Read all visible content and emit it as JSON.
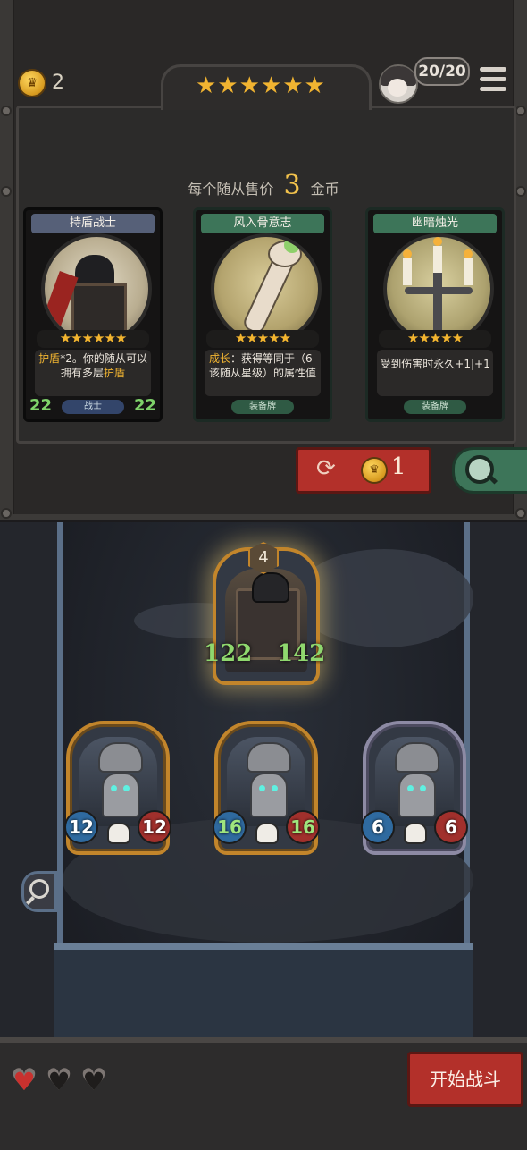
{
  "header": {
    "gold": "2",
    "tier_stars": "★★★★★★",
    "population": "20/20"
  },
  "shop": {
    "price_prefix": "每个随从售价",
    "price_value": "3",
    "price_suffix": "金币",
    "cards": [
      {
        "title": "持盾战士",
        "stars": "★★★★★★",
        "desc_hl1": "护盾",
        "desc_mid": "*2。你的随从可以拥有多层",
        "desc_hl2": "护盾",
        "type": "战士",
        "attack": "22",
        "health": "22"
      },
      {
        "title": "风入骨意志",
        "stars": "★★★★★",
        "desc_hl1": "成长",
        "desc_mid": "：获得等同于（6-该随从星级）的属性值",
        "type": "装备牌"
      },
      {
        "title": "幽暗烛光",
        "stars": "★★★★★",
        "desc_mid": "受到伤害时永久+1|+1",
        "type": "装备牌"
      }
    ],
    "reroll_cost": "1"
  },
  "board": {
    "selected": {
      "tier": "4",
      "attack": "122",
      "health": "142"
    },
    "minions": [
      {
        "attack": "12",
        "health": "12"
      },
      {
        "attack": "16",
        "health": "16"
      },
      {
        "attack": "6",
        "health": "6"
      }
    ]
  },
  "lives": {
    "total": 3,
    "remaining": 1
  },
  "start_battle_label": "开始战斗",
  "colors": {
    "accent_gold": "#f1b431",
    "button_red": "#b3302a",
    "stat_green": "#8fd86e"
  }
}
